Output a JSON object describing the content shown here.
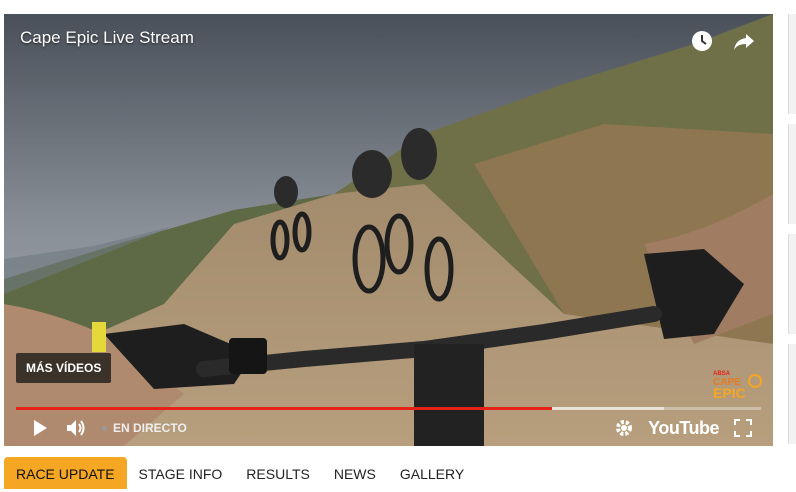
{
  "video": {
    "title": "Cape Epic Live Stream",
    "more_videos_label": "MÁS VÍDEOS",
    "live_label": "EN DIRECTO",
    "youtube_label": "YouTube",
    "logo_lines": [
      "ABSA",
      "CAPE",
      "EPIC"
    ],
    "progress": {
      "played_fraction": 0.72,
      "buffered_fraction": 0.87
    },
    "icons": {
      "watch_later": "clock-icon",
      "share": "share-icon",
      "play": "play-icon",
      "volume": "volume-icon",
      "settings": "gear-icon",
      "fullscreen": "fullscreen-icon"
    }
  },
  "tabs": [
    {
      "label": "RACE UPDATE",
      "active": true
    },
    {
      "label": "STAGE INFO",
      "active": false
    },
    {
      "label": "RESULTS",
      "active": false
    },
    {
      "label": "NEWS",
      "active": false
    },
    {
      "label": "GALLERY",
      "active": false
    }
  ],
  "colors": {
    "accent": "#f5a623",
    "progress": "#e62117"
  }
}
